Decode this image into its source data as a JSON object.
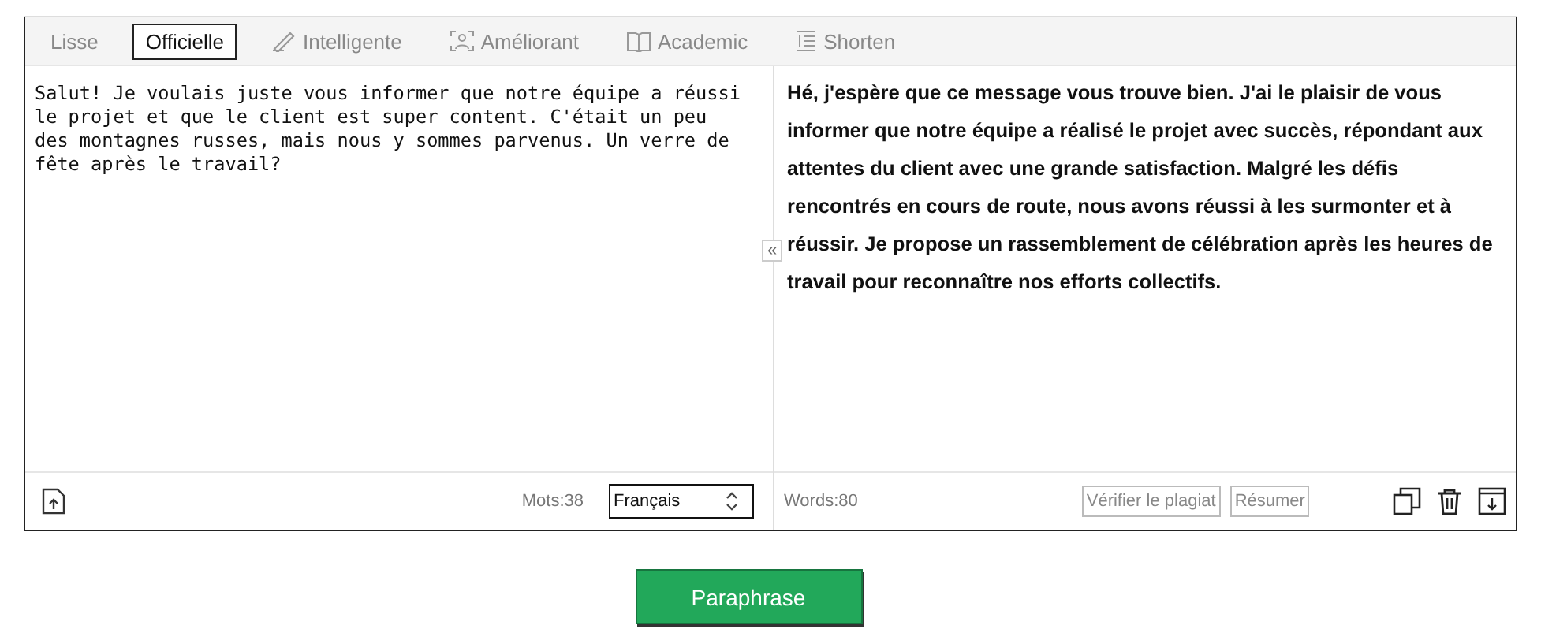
{
  "tabs": [
    {
      "label": "Lisse",
      "selected": false,
      "kind": "text"
    },
    {
      "label": "Officielle",
      "selected": true,
      "kind": "text"
    },
    {
      "label": "Intelligente",
      "selected": false,
      "kind": "icon"
    },
    {
      "label": "Améliorant",
      "selected": false,
      "kind": "icon"
    },
    {
      "label": "Academic",
      "selected": false,
      "kind": "icon"
    },
    {
      "label": "Shorten",
      "selected": false,
      "kind": "icon"
    }
  ],
  "input": {
    "value": "Salut! Je voulais juste vous informer que notre équipe a réussi le projet et que le client est super content. C'était un peu des montagnes russes, mais nous y sommes parvenus. Un verre de fête après le travail?",
    "word_count": "Mots:38",
    "language": "Français"
  },
  "collapse": "«",
  "output": {
    "text": "Hé, j'espère que ce message vous trouve bien. J'ai le plaisir de vous informer que notre équipe a réalisé le projet avec succès, répondant aux attentes du client avec une grande satisfaction. Malgré les défis rencontrés en cours de route, nous avons réussi à les surmonter et à réussir. Je propose un rassemblement de célébration après les heures de travail pour reconnaître nos efforts collectifs.",
    "word_count": "Words:80",
    "buttons": [
      "Vérifier le plagiat",
      "Résumer"
    ]
  },
  "submit": "Paraphrase"
}
